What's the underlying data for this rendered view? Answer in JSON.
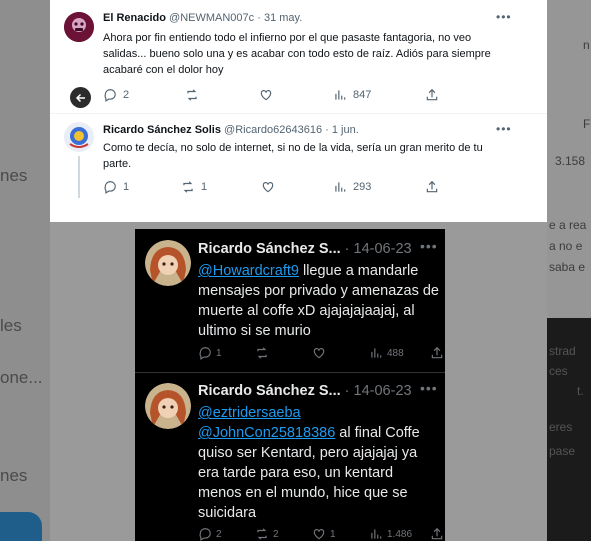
{
  "background": {
    "left_fragments": [
      "nes",
      "les",
      "one...",
      "nes"
    ],
    "right_fragments": [
      "n",
      "F",
      "3.158",
      "e a rea",
      "a no e",
      "saba e",
      "strad",
      "ces",
      "t.",
      "eres",
      "pase"
    ]
  },
  "light_thread": {
    "tweets": [
      {
        "author": "El Renacido",
        "handle": "@NEWMAN007c",
        "date": "· 31 may.",
        "text": "Ahora por fin entiendo todo el infierno por el que pasaste fantagoria, no veo salidas... bueno solo una y es acabar con todo esto de raíz. Adiós para siempre acabaré con el dolor hoy",
        "replies": "2",
        "retweets": "",
        "likes": "",
        "views": "847"
      },
      {
        "author": "Ricardo Sánchez Solis",
        "handle": "@Ricardo62643616",
        "date": "· 1 jun.",
        "text": "Como te decía, no solo de internet, si no de la vida, sería un gran merito de tu parte.",
        "replies": "1",
        "retweets": "1",
        "likes": "",
        "views": "293"
      }
    ]
  },
  "dark_thread": {
    "tweets": [
      {
        "author": "Ricardo Sánchez S...",
        "date": "· 14-06-23",
        "mentions": [
          "@Howardcraft9"
        ],
        "text": " llegue a mandarle mensajes por privado y amenazas de muerte al coffe xD ajajajajaajaj, al ultimo si se murio",
        "replies": "1",
        "retweets": "",
        "likes": "",
        "views": "488"
      },
      {
        "author": "Ricardo Sánchez S...",
        "date": "· 14-06-23",
        "mentions": [
          "@eztridersaeba",
          "@JohnCon25818386"
        ],
        "text": " al final Coffe quiso ser Kentard, pero ajajajaj ya era tarde para eso, un kentard menos en el mundo, hice que se suicidara",
        "replies": "2",
        "retweets": "2",
        "likes": "1",
        "views": "1.486"
      }
    ]
  },
  "colors": {
    "light_bg": "#ffffff",
    "dark_bg": "#000000",
    "link": "#1d9bf0",
    "secondary_text": "#536471"
  }
}
